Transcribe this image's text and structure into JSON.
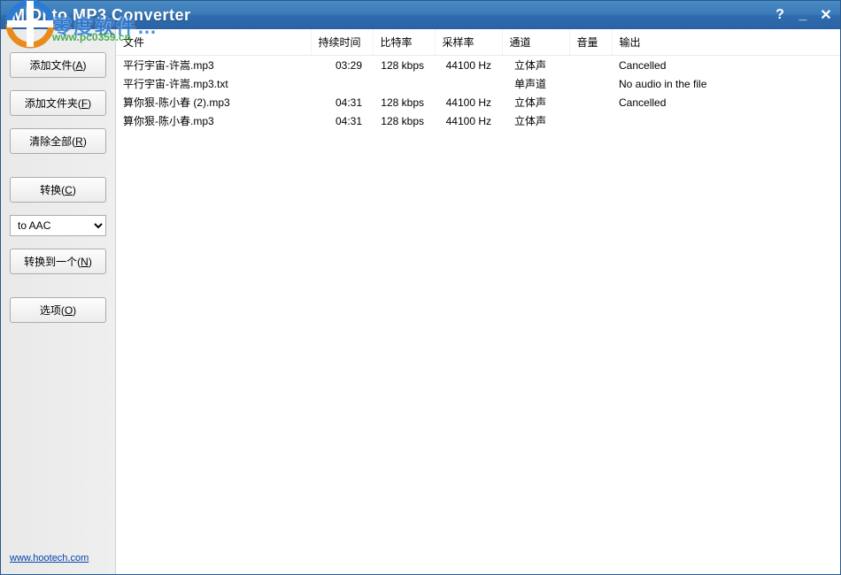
{
  "title": "MIDI to MP3 Converter",
  "watermark": {
    "line1": "零度软件…",
    "line2": "www.pc0359.cn"
  },
  "titlebar": {
    "help": "?",
    "min": "_",
    "close": "✕"
  },
  "sidebar": {
    "add_file": {
      "label": "添加文件(",
      "key": "A",
      "suffix": ")"
    },
    "add_folder": {
      "label": "添加文件夹(",
      "key": "F",
      "suffix": ")"
    },
    "clear_all": {
      "label": "清除全部(",
      "key": "R",
      "suffix": ")"
    },
    "convert": {
      "label": "转换(",
      "key": "C",
      "suffix": ")"
    },
    "format_selected": "to AAC",
    "convert_one": {
      "label": "转换到一个(",
      "key": "N",
      "suffix": ")"
    },
    "options": {
      "label": "选项(",
      "key": "O",
      "suffix": ")"
    },
    "footer_link": "www.hootech.com"
  },
  "columns": {
    "file": "文件",
    "duration": "持续时间",
    "bitrate": "比特率",
    "samplerate": "采样率",
    "channel": "通道",
    "volume": "音量",
    "output": "输出"
  },
  "rows": [
    {
      "file": "平行宇宙-许嵩.mp3",
      "duration": "03:29",
      "bitrate": "128 kbps",
      "samplerate": "44100 Hz",
      "channel": "立体声",
      "volume": "",
      "output": "Cancelled"
    },
    {
      "file": "平行宇宙-许嵩.mp3.txt",
      "duration": "",
      "bitrate": "",
      "samplerate": "",
      "channel": "单声道",
      "volume": "",
      "output": "No audio in the file"
    },
    {
      "file": "算你狠-陈小春 (2).mp3",
      "duration": "04:31",
      "bitrate": "128 kbps",
      "samplerate": "44100 Hz",
      "channel": "立体声",
      "volume": "",
      "output": "Cancelled"
    },
    {
      "file": "算你狠-陈小春.mp3",
      "duration": "04:31",
      "bitrate": "128 kbps",
      "samplerate": "44100 Hz",
      "channel": "立体声",
      "volume": "",
      "output": ""
    }
  ]
}
